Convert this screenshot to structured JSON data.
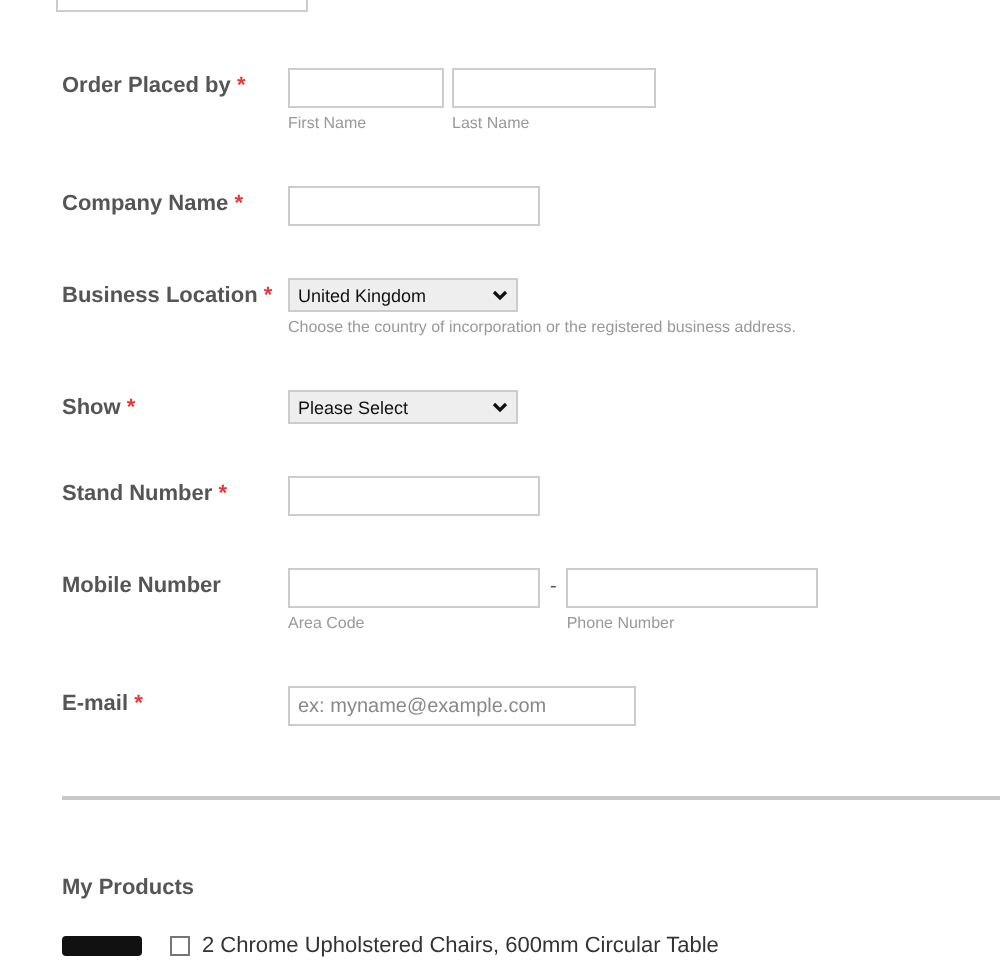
{
  "fields": [
    {
      "label": "Order Placed by",
      "required_mark": "*",
      "inputs": [
        {
          "kind": "input",
          "sublabel": "First Name"
        },
        {
          "kind": "input",
          "sublabel": "Last Name"
        }
      ]
    },
    {
      "label": "Company Name",
      "required_mark": "*",
      "inputs": [
        {
          "kind": "input"
        }
      ]
    },
    {
      "label": "Business Location",
      "required_mark": "*",
      "inputs": [
        {
          "kind": "select",
          "value": "United Kingdom"
        }
      ],
      "hint": "Choose the country of incorporation or the registered business address."
    },
    {
      "label": "Show",
      "required_mark": "*",
      "inputs": [
        {
          "kind": "select",
          "value": "Please Select"
        }
      ]
    },
    {
      "label": "Stand Number",
      "required_mark": "*",
      "inputs": [
        {
          "kind": "input"
        }
      ]
    },
    {
      "label": "Mobile Number",
      "inputs": [
        {
          "kind": "input",
          "sublabel": "Area Code"
        },
        {
          "kind": "separator",
          "text": "-"
        },
        {
          "kind": "input",
          "sublabel": "Phone Number"
        }
      ]
    },
    {
      "label": "E-mail",
      "required_mark": "*",
      "inputs": [
        {
          "kind": "input",
          "placeholder": "ex: myname@example.com"
        }
      ]
    }
  ],
  "products": {
    "title": "My Products",
    "items": [
      {
        "name": "2 Chrome Upholstered Chairs, 600mm Circular Table",
        "checked": false
      }
    ]
  }
}
